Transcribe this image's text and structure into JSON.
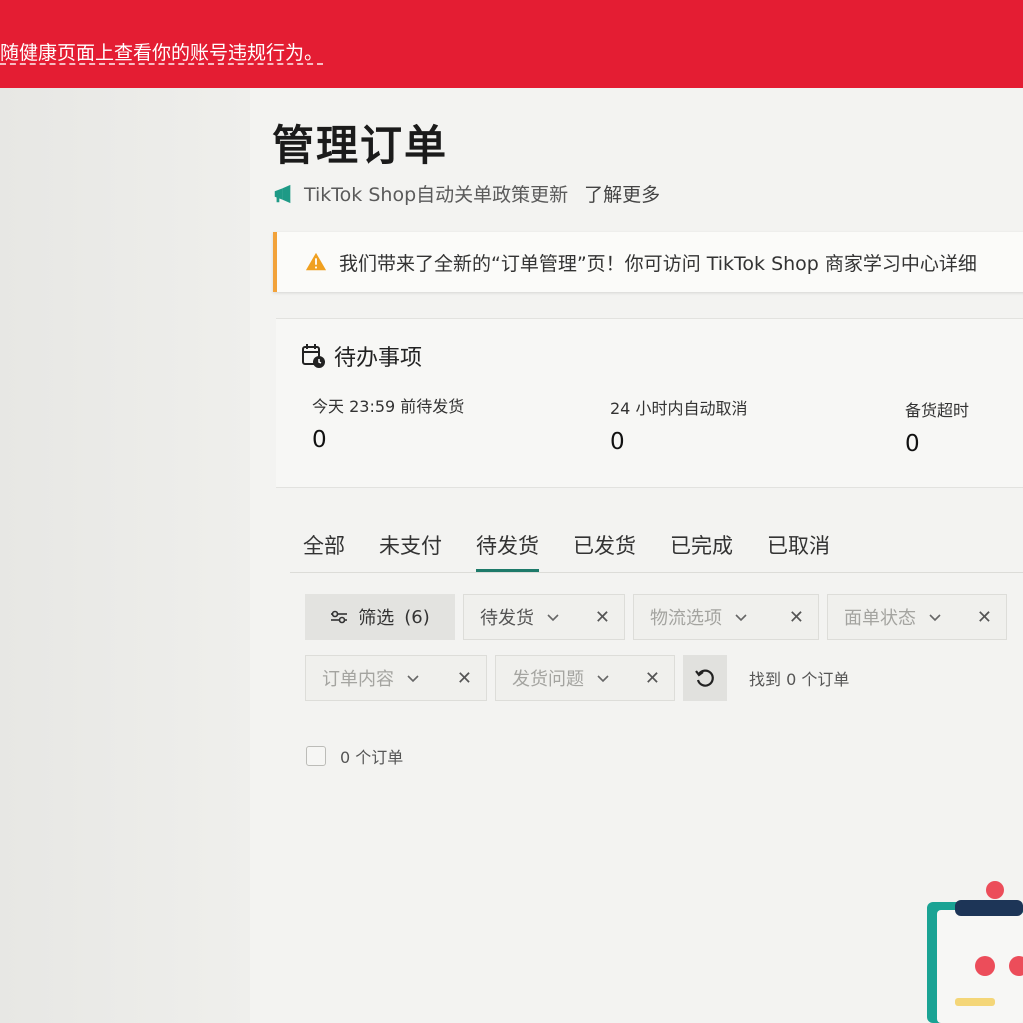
{
  "banner": {
    "message": "随健康页面上查看你的账号违规行为。"
  },
  "page": {
    "title": "管理订单"
  },
  "notice": {
    "text": "TikTok Shop自动关单政策更新",
    "link": "了解更多"
  },
  "alert": {
    "text": "我们带来了全新的“订单管理”页！你可访问 TikTok Shop 商家学习中心详细"
  },
  "todo": {
    "title": "待办事项",
    "items": [
      {
        "label": "今天 23:59 前待发货",
        "value": "0"
      },
      {
        "label": "24 小时内自动取消",
        "value": "0"
      },
      {
        "label": "备货超时",
        "value": "0"
      }
    ]
  },
  "tabs": [
    "全部",
    "未支付",
    "待发货",
    "已发货",
    "已完成",
    "已取消"
  ],
  "active_tab": "待发货",
  "filters": {
    "button_label": "筛选",
    "button_count": "(6)",
    "chips": [
      "待发货",
      "物流选项",
      "面单状态",
      "订单内容",
      "发货问题"
    ],
    "found": "找到 0 个订单"
  },
  "list": {
    "count_label": "0 个订单"
  },
  "colors": {
    "banner": "#e41d33",
    "tab_underline": "#1e7a6a",
    "alert_accent": "#f2a23a",
    "notice_icon": "#1e9a86"
  }
}
